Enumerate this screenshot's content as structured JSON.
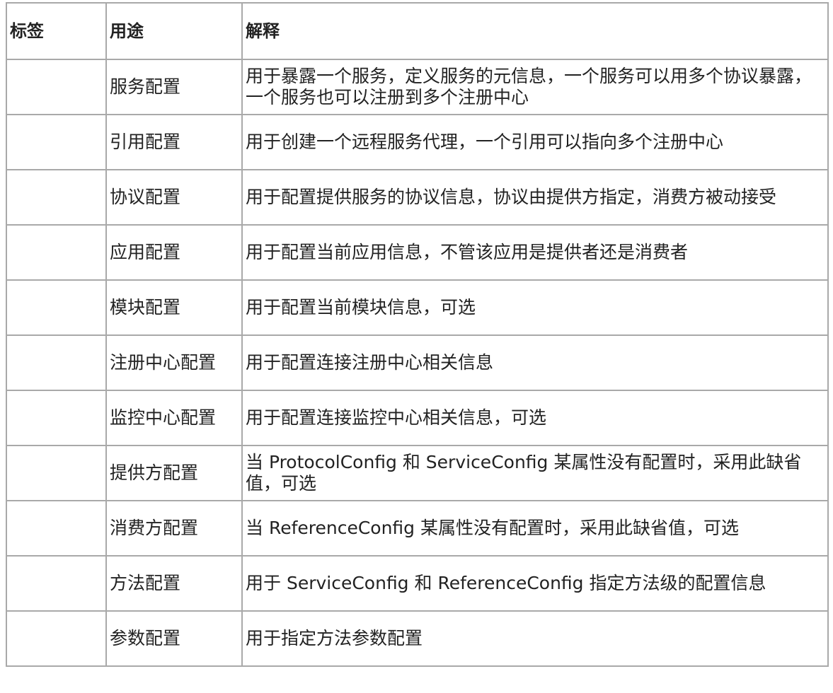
{
  "table": {
    "headers": [
      "标签",
      "用途",
      "解释"
    ],
    "rows": [
      {
        "tag": "",
        "purpose": "服务配置",
        "explanation": "用于暴露一个服务，定义服务的元信息，一个服务可以用多个协议暴露，一个服务也可以注册到多个注册中心"
      },
      {
        "tag": "",
        "purpose": "引用配置",
        "explanation": "用于创建一个远程服务代理，一个引用可以指向多个注册中心"
      },
      {
        "tag": "",
        "purpose": "协议配置",
        "explanation": "用于配置提供服务的协议信息，协议由提供方指定，消费方被动接受"
      },
      {
        "tag": "",
        "purpose": "应用配置",
        "explanation": "用于配置当前应用信息，不管该应用是提供者还是消费者"
      },
      {
        "tag": "",
        "purpose": "模块配置",
        "explanation": "用于配置当前模块信息，可选"
      },
      {
        "tag": "",
        "purpose": "注册中心配置",
        "explanation": "用于配置连接注册中心相关信息"
      },
      {
        "tag": "",
        "purpose": "监控中心配置",
        "explanation": "用于配置连接监控中心相关信息，可选"
      },
      {
        "tag": "",
        "purpose": "提供方配置",
        "explanation": "当 ProtocolConfig 和 ServiceConfig 某属性没有配置时，采用此缺省值，可选"
      },
      {
        "tag": "",
        "purpose": "消费方配置",
        "explanation": "当 ReferenceConfig 某属性没有配置时，采用此缺省值，可选"
      },
      {
        "tag": "",
        "purpose": "方法配置",
        "explanation": "用于 ServiceConfig 和 ReferenceConfig 指定方法级的配置信息"
      },
      {
        "tag": "",
        "purpose": "参数配置",
        "explanation": "用于指定方法参数配置"
      }
    ]
  }
}
